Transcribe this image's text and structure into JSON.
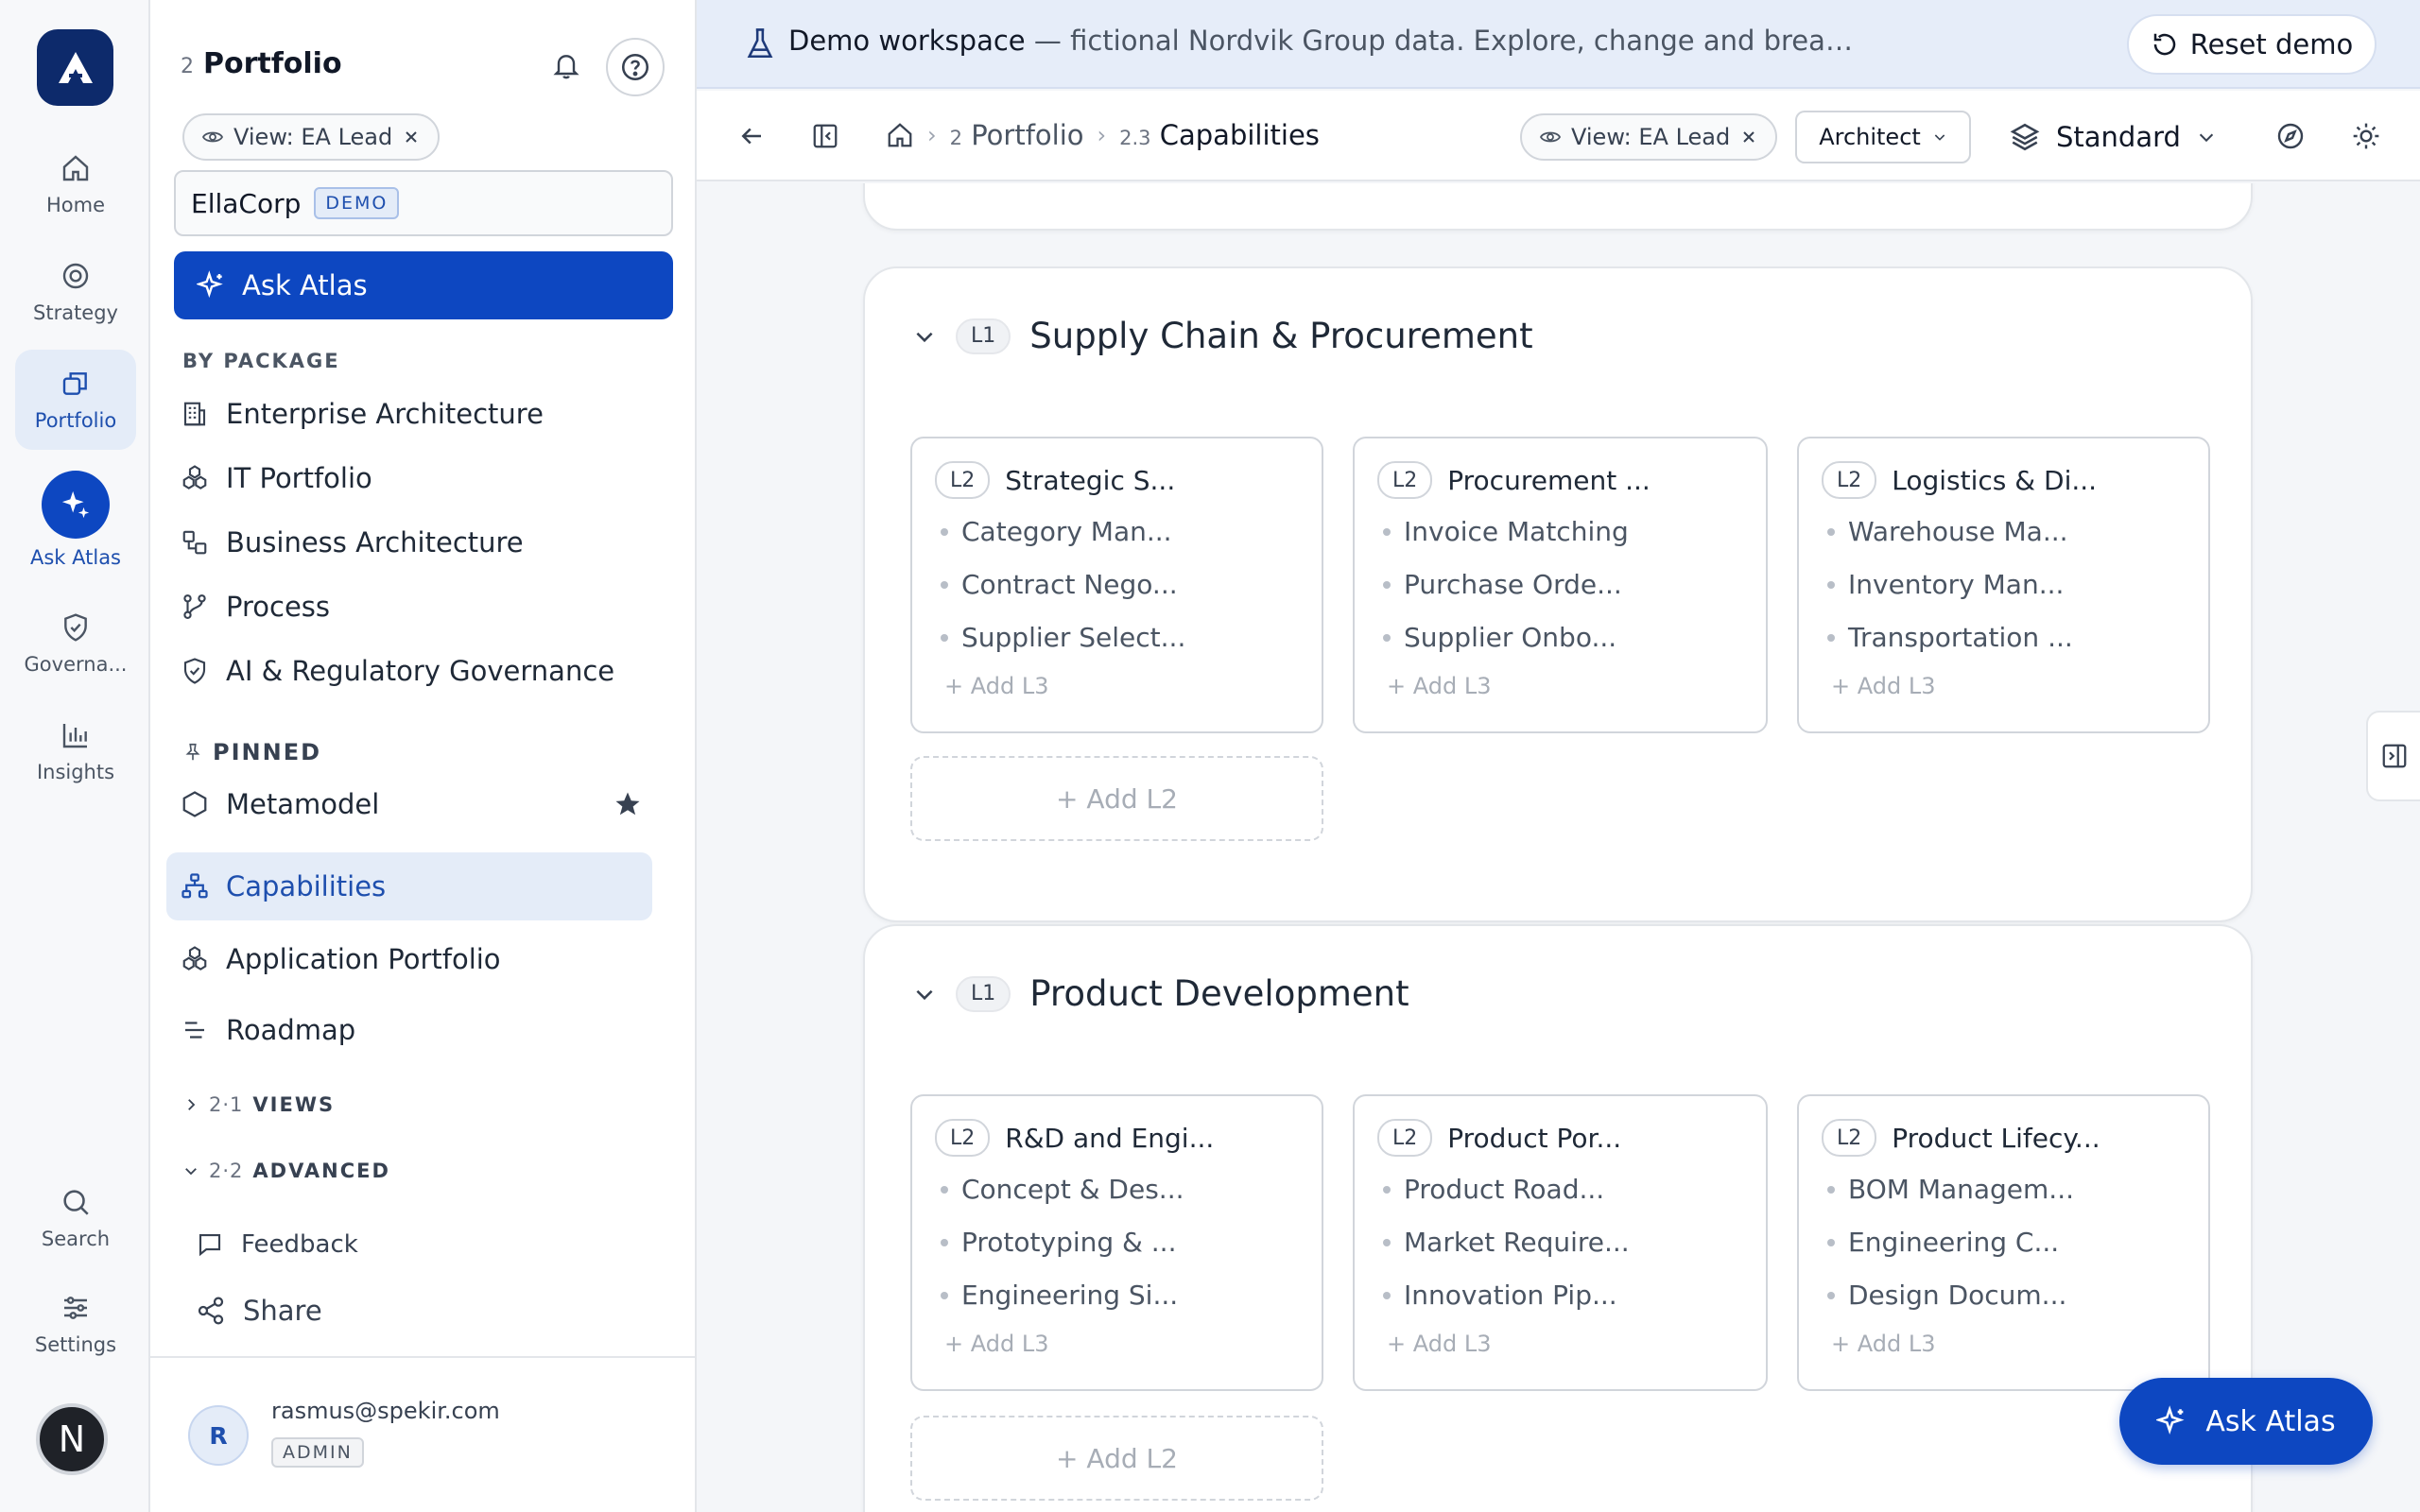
{
  "rail": {
    "items": [
      {
        "label": "Home",
        "icon": "home-icon"
      },
      {
        "label": "Strategy",
        "icon": "target-icon"
      },
      {
        "label": "Portfolio",
        "icon": "portfolio-icon"
      },
      {
        "label": "Ask Atlas",
        "icon": "sparkle-icon"
      },
      {
        "label": "Governa...",
        "icon": "shield-icon"
      },
      {
        "label": "Insights",
        "icon": "bar-chart-icon"
      },
      {
        "label": "Search",
        "icon": "search-icon"
      },
      {
        "label": "Settings",
        "icon": "sliders-icon"
      }
    ],
    "avatar_letter": "N"
  },
  "sidebar": {
    "title_num": "2",
    "title": "Portfolio",
    "view_chip": "View: EA Lead",
    "workspace": "EllaCorp",
    "workspace_badge": "DEMO",
    "ask_label": "Ask Atlas",
    "by_package_label": "BY PACKAGE",
    "packages": [
      {
        "label": "Enterprise Architecture",
        "icon": "building-icon"
      },
      {
        "label": "IT Portfolio",
        "icon": "cubes-icon"
      },
      {
        "label": "Business Architecture",
        "icon": "shapes-icon"
      },
      {
        "label": "Process",
        "icon": "process-icon"
      },
      {
        "label": "AI & Regulatory Governance",
        "icon": "shield-check-icon"
      }
    ],
    "pinned_label": "PINNED",
    "pinned": [
      {
        "label": "Metamodel",
        "icon": "hexagon-icon"
      },
      {
        "label": "Capabilities",
        "icon": "hierarchy-icon"
      },
      {
        "label": "Application Portfolio",
        "icon": "cubes-icon"
      },
      {
        "label": "Roadmap",
        "icon": "roadmap-icon"
      }
    ],
    "views": {
      "num": "2·1",
      "label": "VIEWS"
    },
    "advanced": {
      "num": "2·2",
      "label": "ADVANCED"
    },
    "feedback": "Feedback",
    "share": "Share",
    "user": {
      "initial": "R",
      "email": "rasmus@spekir.com",
      "role": "ADMIN"
    }
  },
  "banner": {
    "strong": "Demo workspace",
    "rest": " — fictional Nordvik Group data. Explore, change and break anything; reset brings it back.",
    "reset": "Reset demo"
  },
  "topbar": {
    "crumb1_num": "2",
    "crumb1": "Portfolio",
    "crumb2_num": "2.3",
    "crumb2": "Capabilities",
    "view_chip": "View: EA Lead",
    "role": "Architect",
    "mode": "Standard"
  },
  "l1s": [
    {
      "badge": "L1",
      "title": "Supply Chain & Procurement",
      "l2s": [
        {
          "badge": "L2",
          "title": "Strategic S...",
          "l3s": [
            "Category Man...",
            "Contract Nego...",
            "Supplier Select..."
          ]
        },
        {
          "badge": "L2",
          "title": "Procurement ...",
          "l3s": [
            "Invoice Matching",
            "Purchase Orde...",
            "Supplier Onbo..."
          ]
        },
        {
          "badge": "L2",
          "title": "Logistics & Di...",
          "l3s": [
            "Warehouse Ma...",
            "Inventory Man...",
            "Transportation ..."
          ]
        }
      ]
    },
    {
      "badge": "L1",
      "title": "Product Development",
      "l2s": [
        {
          "badge": "L2",
          "title": "R&D and Engi...",
          "l3s": [
            "Concept & Des...",
            "Prototyping & ...",
            "Engineering Si..."
          ]
        },
        {
          "badge": "L2",
          "title": "Product Por...",
          "l3s": [
            "Product Road...",
            "Market Require...",
            "Innovation Pip..."
          ]
        },
        {
          "badge": "L2",
          "title": "Product Lifecy...",
          "l3s": [
            "BOM Managem...",
            "Engineering C...",
            "Design Docum..."
          ]
        }
      ]
    }
  ],
  "add_l3": "+ Add L3",
  "add_l2": "+ Add L2",
  "fab": "Ask Atlas",
  "colors": {
    "brand_navy": "#0d2a6b",
    "accent_blue": "#0d47c1",
    "active_bg": "#e4ecf8",
    "banner_bg": "#e6edf9"
  }
}
